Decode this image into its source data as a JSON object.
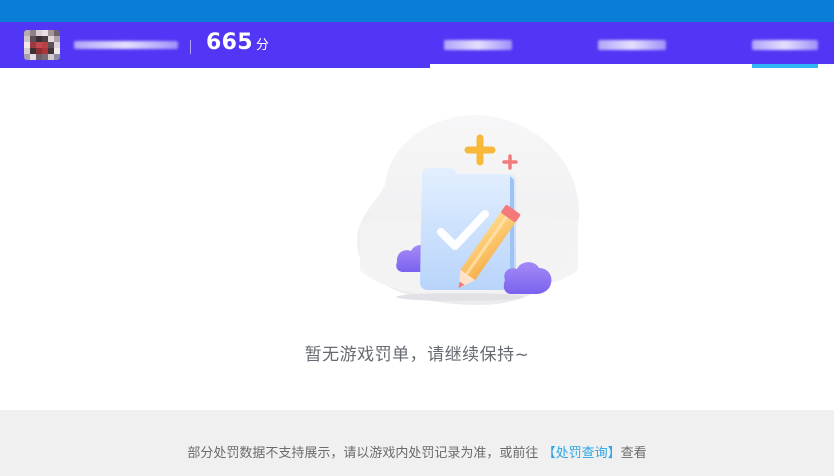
{
  "header": {
    "score_value": "665",
    "score_unit": "分"
  },
  "empty_state": {
    "message": "暂无游戏罚单，请继续保持~"
  },
  "footer": {
    "note_prefix": "部分处罚数据不支持展示，请以游戏内处罚记录为准，或前往",
    "link_text": "【处罚查询】",
    "note_suffix": "查看"
  },
  "colors": {
    "topstrip": "#0a7dd6",
    "header_bg": "#5136f5",
    "active_underline": "#31b6f5",
    "link": "#2aa6e6",
    "footer_bg": "#f0f0f0"
  },
  "icons": {
    "illustration": "empty-document-check-pencil-illustration"
  }
}
